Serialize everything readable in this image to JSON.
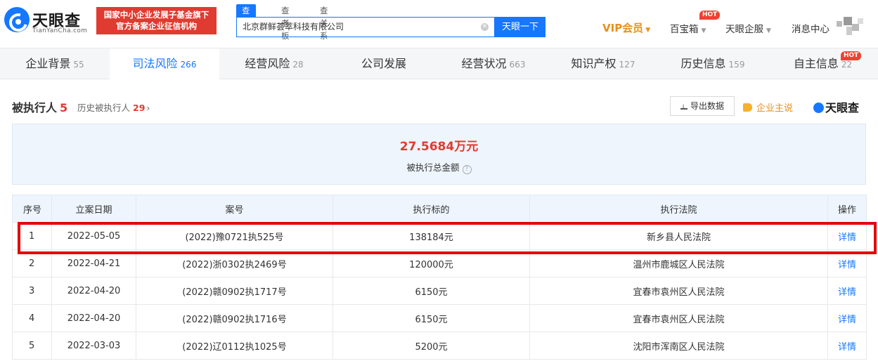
{
  "header": {
    "logo_text": "天眼查",
    "logo_sub": "TianYanCha.com",
    "banner_line1": "国家中小企业发展子基金旗下",
    "banner_line2": "官方备案企业征信机构",
    "search_tabs": [
      "查公司",
      "查老板",
      "查关系"
    ],
    "search_value": "北京群鲜荟萃科技有限公司",
    "search_button": "天眼一下",
    "nav": {
      "vip": "VIP会员",
      "treasure": "百宝箱",
      "hot": "HOT",
      "enterprise": "天眼企服",
      "messages": "消息中心"
    }
  },
  "categories": [
    {
      "label": "企业背景",
      "count": "55"
    },
    {
      "label": "司法风险",
      "count": "266"
    },
    {
      "label": "经营风险",
      "count": "28"
    },
    {
      "label": "公司发展",
      "count": ""
    },
    {
      "label": "经营状况",
      "count": "663"
    },
    {
      "label": "知识产权",
      "count": "127"
    },
    {
      "label": "历史信息",
      "count": "159"
    },
    {
      "label": "自主信息",
      "count": "22"
    }
  ],
  "category_hot": "HOT",
  "section": {
    "title": "被执行人",
    "count": "5",
    "history_label": "历史被执行人",
    "history_count": "29",
    "export_label": "导出数据",
    "claim_label": "企业主说",
    "brand": "天眼查"
  },
  "summary": {
    "amount": "27.5684万元",
    "label": "被执行总金额"
  },
  "table": {
    "headers": [
      "序号",
      "立案日期",
      "案号",
      "执行标的",
      "执行法院",
      "操作"
    ],
    "rows": [
      {
        "seq": "1",
        "date": "2022-05-05",
        "case": "(2022)豫0721执525号",
        "amount": "138184元",
        "court": "新乡县人民法院",
        "action": "详情"
      },
      {
        "seq": "2",
        "date": "2022-04-21",
        "case": "(2022)浙0302执2469号",
        "amount": "120000元",
        "court": "温州市鹿城区人民法院",
        "action": "详情"
      },
      {
        "seq": "3",
        "date": "2022-04-20",
        "case": "(2022)赣0902执1717号",
        "amount": "6150元",
        "court": "宜春市袁州区人民法院",
        "action": "详情"
      },
      {
        "seq": "4",
        "date": "2022-04-20",
        "case": "(2022)赣0902执1716号",
        "amount": "6150元",
        "court": "宜春市袁州区人民法院",
        "action": "详情"
      },
      {
        "seq": "5",
        "date": "2022-03-03",
        "case": "(2022)辽0112执1025号",
        "amount": "5200元",
        "court": "沈阳市浑南区人民法院",
        "action": "详情"
      }
    ]
  },
  "colors": {
    "brand_blue": "#1677ff",
    "risk_red": "#e03b30",
    "vip_orange": "#e8901c",
    "highlight_red": "#e6000a"
  }
}
